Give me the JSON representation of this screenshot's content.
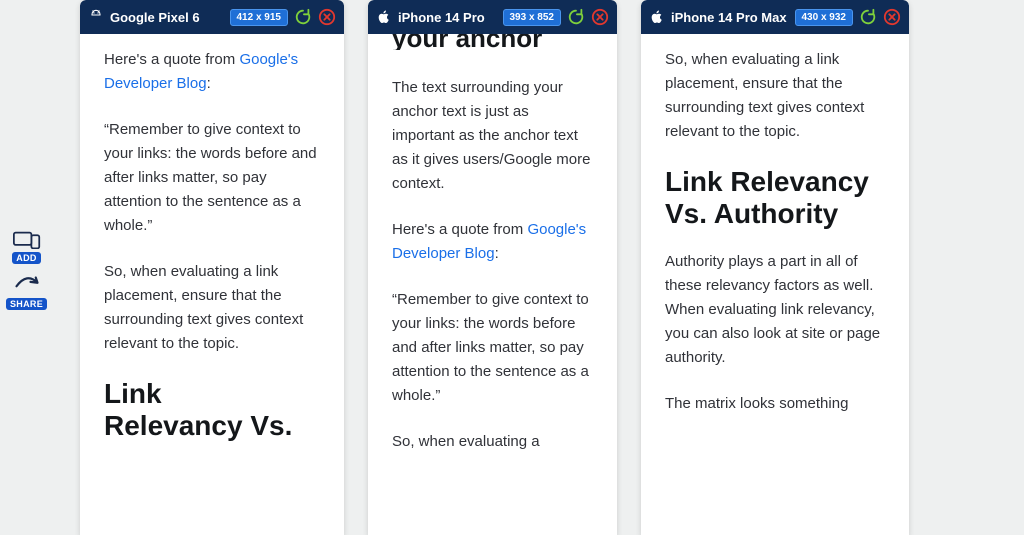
{
  "side_tools": {
    "add_label": "ADD",
    "share_label": "SHARE"
  },
  "devices": [
    {
      "name": "Google Pixel 6",
      "platform": "android",
      "dimensions": "412 x 915"
    },
    {
      "name": "iPhone 14 Pro",
      "platform": "apple",
      "dimensions": "393 x 852"
    },
    {
      "name": "iPhone 14 Pro Max",
      "platform": "apple",
      "dimensions": "430 x 932"
    }
  ],
  "article": {
    "partial_top": "your anchor text.",
    "quote_intro_prefix": "Here's a quote from ",
    "quote_link_text": "Google's Developer Blog",
    "quote_intro_suffix": ":",
    "surrounding_text_para": "The text surrounding your anchor text is just as important as the anchor text as it gives users/Google more context.",
    "quote_body": "“Remember to give context to your links: the words before and after links matter, so pay attention to the sentence as a whole.”",
    "eval_para": "So, when evaluating a link placement, ensure that the surrounding text gives context relevant to the topic.",
    "eval_para_partial": "So, when evaluating a",
    "heading_relevancy": "Link Relevancy Vs. Authority",
    "heading_relevancy_split1": "Link",
    "heading_relevancy_split2": "Relevancy Vs.",
    "authority_para": "Authority plays a part in all of these relevancy factors as well. When evaluating link relevancy, you can also look at site or page authority.",
    "matrix_para": "The matrix looks something"
  }
}
